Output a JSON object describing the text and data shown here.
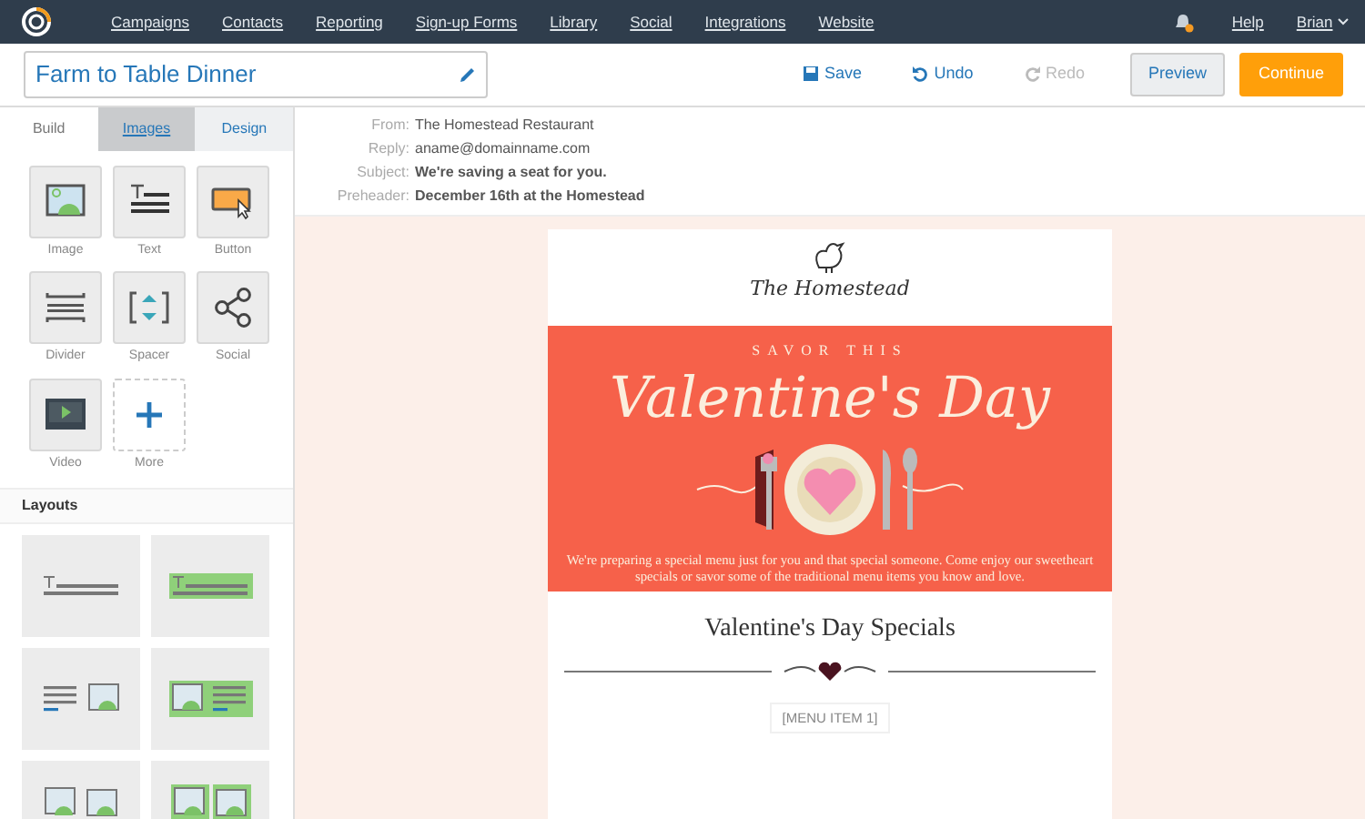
{
  "nav": {
    "items": [
      "Campaigns",
      "Contacts",
      "Reporting",
      "Sign-up Forms",
      "Library",
      "Social",
      "Integrations",
      "Website"
    ],
    "help": "Help",
    "user": "Brian"
  },
  "toolbar": {
    "campaign_name": "Farm to Table Dinner",
    "actions": [
      {
        "label": "Save",
        "kind": "save",
        "disabled": false
      },
      {
        "label": "Undo",
        "kind": "undo",
        "disabled": false
      },
      {
        "label": "Redo",
        "kind": "redo",
        "disabled": true
      }
    ],
    "preview": "Preview",
    "continue": "Continue"
  },
  "sidebar": {
    "tabs": [
      {
        "label": "Build",
        "selected": true,
        "hovered": false
      },
      {
        "label": "Images",
        "selected": false,
        "hovered": true
      },
      {
        "label": "Design",
        "selected": false,
        "hovered": false
      }
    ],
    "blocks": [
      {
        "label": "Image",
        "kind": "image"
      },
      {
        "label": "Text",
        "kind": "text"
      },
      {
        "label": "Button",
        "kind": "button"
      },
      {
        "label": "Divider",
        "kind": "divider"
      },
      {
        "label": "Spacer",
        "kind": "spacer"
      },
      {
        "label": "Social",
        "kind": "social"
      },
      {
        "label": "Video",
        "kind": "video"
      },
      {
        "label": "More",
        "kind": "more"
      }
    ],
    "layouts_title": "Layouts",
    "layouts": [
      {
        "kind": "text",
        "highlighted": false
      },
      {
        "kind": "text",
        "highlighted": true
      },
      {
        "kind": "text-image",
        "highlighted": false
      },
      {
        "kind": "image-text",
        "highlighted": true
      },
      {
        "kind": "two-column",
        "highlighted": false
      },
      {
        "kind": "two-column",
        "highlighted": true
      }
    ]
  },
  "header": [
    {
      "label": "From:",
      "value": "The Homestead Restaurant",
      "bold": false
    },
    {
      "label": "Reply:",
      "value": "aname@domainname.com",
      "bold": false
    },
    {
      "label": "Subject:",
      "value": "We're saving a seat for you.",
      "bold": true
    },
    {
      "label": "Preheader:",
      "value": "December 16th at the Homestead",
      "bold": true
    }
  ],
  "email": {
    "logo": "The Homestead",
    "banner": {
      "kicker": "SAVOR THIS",
      "title": "Valentine's Day",
      "text": "We're preparing a special menu just for you and that special someone. Come enjoy our sweetheart specials or savor some of the traditional menu items you know and love."
    },
    "heading": "Valentine's Day Specials",
    "menu_item": "[MENU ITEM 1]"
  }
}
